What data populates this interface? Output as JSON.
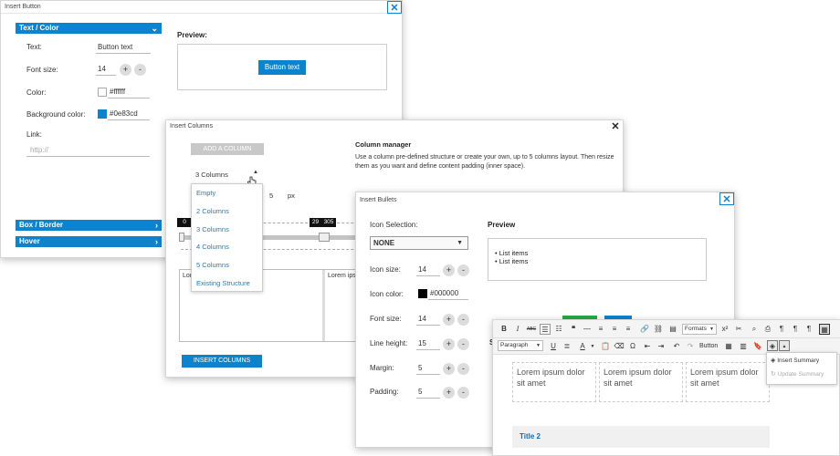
{
  "insert_button": {
    "title": "Insert Button",
    "section_text_color": "Text / Color",
    "text_label": "Text:",
    "text_value": "Button text",
    "font_size_label": "Font size:",
    "font_size_value": "14",
    "color_label": "Color:",
    "color_value": "#ffffff",
    "bg_color_label": "Background color:",
    "bg_color_value": "#0e83cd",
    "link_label": "Link:",
    "link_placeholder": "http://",
    "preview_label": "Preview:",
    "preview_button": "Button text",
    "section_box_border": "Box / Border",
    "section_hover": "Hover",
    "close": "✕",
    "plus": "+",
    "minus": "-",
    "chevron_down": "⌄",
    "chevron_right": "›",
    "colors": {
      "accent": "#0e83cd",
      "text_color": "#ffffff"
    }
  },
  "insert_columns": {
    "title": "Insert Columns",
    "add_column": "ADD A COLUMN",
    "selected": "3 Columns",
    "options": [
      "Empty",
      "2 Columns",
      "3 Columns",
      "4 Columns",
      "5 Columns",
      "Existing Structure"
    ],
    "padding_value": "5",
    "padding_unit": "px",
    "slider_left": "0",
    "slider_mid_a": "29",
    "slider_mid_b": "305",
    "manager_title": "Column manager",
    "manager_desc": "Use a column pre-defined structure or create your own, up to 5 columns layout. Then resize them as you want and define content padding (inner space).",
    "col_text_a": "Lor",
    "col_text_b": "Lorem ipsu",
    "insert_btn": "INSERT COLUMNS",
    "close": "✕"
  },
  "insert_bullets": {
    "title": "Insert Bullets",
    "icon_selection_label": "Icon Selection:",
    "icon_selection_value": "NONE",
    "icon_size_label": "Icon size:",
    "icon_size_value": "14",
    "icon_color_label": "Icon color:",
    "icon_color_value": "#000000",
    "font_size_label": "Font size:",
    "font_size_value": "14",
    "line_height_label": "Line height:",
    "line_height_value": "15",
    "margin_label": "Margin:",
    "margin_value": "5",
    "padding_label": "Padding:",
    "padding_value": "5",
    "preview_label": "Preview",
    "preview_items": [
      "List items",
      "List items"
    ],
    "close": "✕",
    "plus": "+",
    "minus": "-"
  },
  "editor": {
    "formats": "Formats",
    "paragraph": "Paragraph",
    "button_label": "Button",
    "lorem": "Lorem ipsum dolor sit amet",
    "title2": "Title 2",
    "menu_insert_summary": "Insert Summary",
    "menu_update_summary": "Update Summary",
    "partial_letter": "S"
  }
}
